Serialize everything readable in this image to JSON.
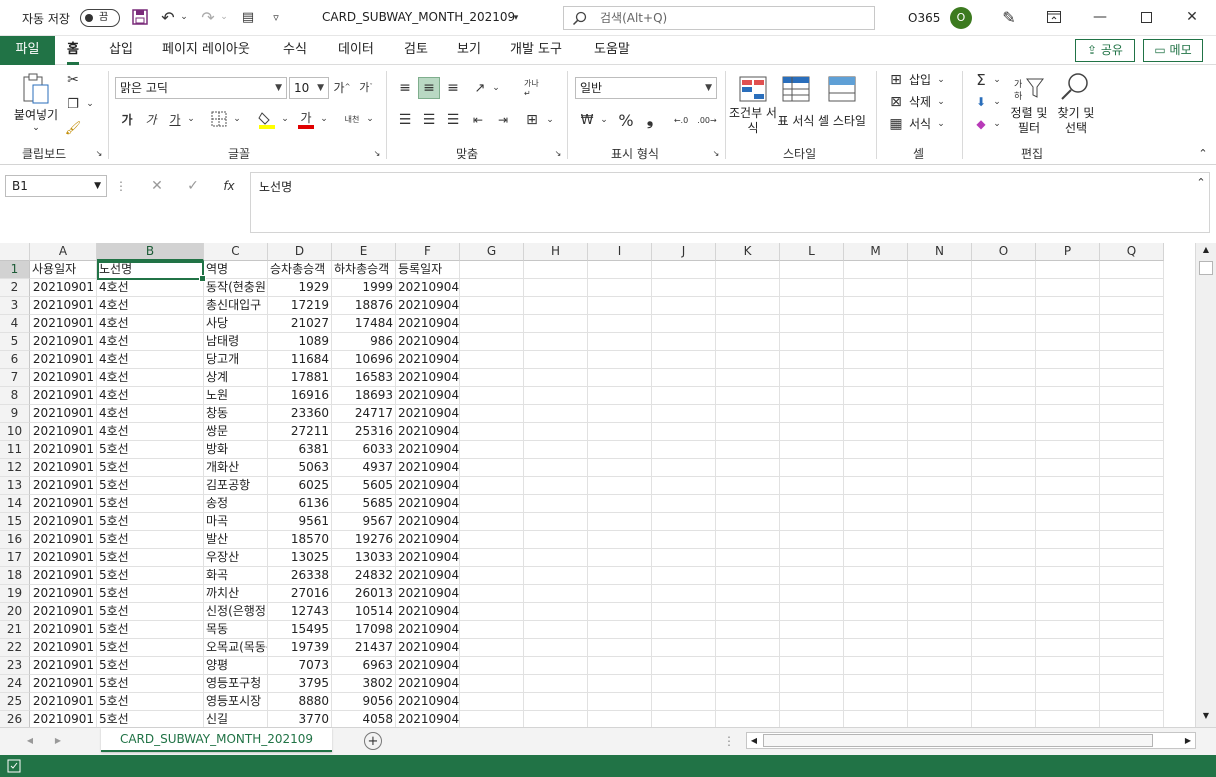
{
  "titlebar": {
    "autosave_label": "자동 저장",
    "autosave_state": "끔",
    "doc_title": "CARD_SUBWAY_MONTH_202109",
    "search_placeholder": "검색(Alt+Q)",
    "account": "O365",
    "avatar_initial": "O"
  },
  "menu": {
    "file": "파일",
    "tabs": [
      "홈",
      "삽입",
      "페이지 레이아웃",
      "수식",
      "데이터",
      "검토",
      "보기",
      "개발 도구",
      "도움말"
    ],
    "share": "공유",
    "memo": "메모"
  },
  "ribbon": {
    "clipboard": {
      "paste": "붙여넣기",
      "label": "클립보드"
    },
    "font": {
      "name": "맑은 고딕",
      "size": "10",
      "bold": "가",
      "italic": "가",
      "underline": "가",
      "font_color": "가",
      "label": "글꼴"
    },
    "alignment": {
      "label": "맞춤"
    },
    "number": {
      "format": "일반",
      "label": "표시 형식"
    },
    "styles": {
      "conditional": "조건부 서식",
      "table": "표 서식",
      "cell": "셀 스타일",
      "label": "스타일"
    },
    "cells": {
      "insert": "삽입",
      "delete": "삭제",
      "format": "서식",
      "label": "셀"
    },
    "editing": {
      "sort": "정렬 및 필터",
      "find": "찾기 및 선택",
      "label": "편집"
    }
  },
  "formula_bar": {
    "name_box": "B1",
    "content": "노선명"
  },
  "sheet": {
    "columns": [
      "A",
      "B",
      "C",
      "D",
      "E",
      "F",
      "G",
      "H",
      "I",
      "J",
      "K",
      "L",
      "M",
      "N",
      "O",
      "P",
      "Q"
    ],
    "selected_column": "B",
    "selected_row": "1",
    "row_numbers": [
      "1",
      "2",
      "3",
      "4",
      "5",
      "6",
      "7",
      "8",
      "9",
      "10",
      "11",
      "12",
      "13",
      "14",
      "15",
      "16",
      "17",
      "18",
      "19",
      "20",
      "21",
      "22",
      "23",
      "24",
      "25",
      "26"
    ],
    "rows": [
      [
        "사용일자",
        "노선명",
        "역명",
        "승차총승객",
        "하차총승객",
        "등록일자"
      ],
      [
        "20210901",
        "4호선",
        "동작(현충원)",
        "1929",
        "1999",
        "20210904"
      ],
      [
        "20210901",
        "4호선",
        "총신대입구",
        "17219",
        "18876",
        "20210904"
      ],
      [
        "20210901",
        "4호선",
        "사당",
        "21027",
        "17484",
        "20210904"
      ],
      [
        "20210901",
        "4호선",
        "남태령",
        "1089",
        "986",
        "20210904"
      ],
      [
        "20210901",
        "4호선",
        "당고개",
        "11684",
        "10696",
        "20210904"
      ],
      [
        "20210901",
        "4호선",
        "상계",
        "17881",
        "16583",
        "20210904"
      ],
      [
        "20210901",
        "4호선",
        "노원",
        "16916",
        "18693",
        "20210904"
      ],
      [
        "20210901",
        "4호선",
        "창동",
        "23360",
        "24717",
        "20210904"
      ],
      [
        "20210901",
        "4호선",
        "쌍문",
        "27211",
        "25316",
        "20210904"
      ],
      [
        "20210901",
        "5호선",
        "방화",
        "6381",
        "6033",
        "20210904"
      ],
      [
        "20210901",
        "5호선",
        "개화산",
        "5063",
        "4937",
        "20210904"
      ],
      [
        "20210901",
        "5호선",
        "김포공항",
        "6025",
        "5605",
        "20210904"
      ],
      [
        "20210901",
        "5호선",
        "송정",
        "6136",
        "5685",
        "20210904"
      ],
      [
        "20210901",
        "5호선",
        "마곡",
        "9561",
        "9567",
        "20210904"
      ],
      [
        "20210901",
        "5호선",
        "발산",
        "18570",
        "19276",
        "20210904"
      ],
      [
        "20210901",
        "5호선",
        "우장산",
        "13025",
        "13033",
        "20210904"
      ],
      [
        "20210901",
        "5호선",
        "화곡",
        "26338",
        "24832",
        "20210904"
      ],
      [
        "20210901",
        "5호선",
        "까치산",
        "27016",
        "26013",
        "20210904"
      ],
      [
        "20210901",
        "5호선",
        "신정(은행정)",
        "12743",
        "10514",
        "20210904"
      ],
      [
        "20210901",
        "5호선",
        "목동",
        "15495",
        "17098",
        "20210904"
      ],
      [
        "20210901",
        "5호선",
        "오목교(목동운동장앞)",
        "19739",
        "21437",
        "20210904"
      ],
      [
        "20210901",
        "5호선",
        "양평",
        "7073",
        "6963",
        "20210904"
      ],
      [
        "20210901",
        "5호선",
        "영등포구청",
        "3795",
        "3802",
        "20210904"
      ],
      [
        "20210901",
        "5호선",
        "영등포시장",
        "8880",
        "9056",
        "20210904"
      ],
      [
        "20210901",
        "5호선",
        "신길",
        "3770",
        "4058",
        "20210904"
      ]
    ],
    "sheet_tab": "CARD_SUBWAY_MONTH_202109"
  },
  "colors": {
    "accent": "#217346"
  }
}
